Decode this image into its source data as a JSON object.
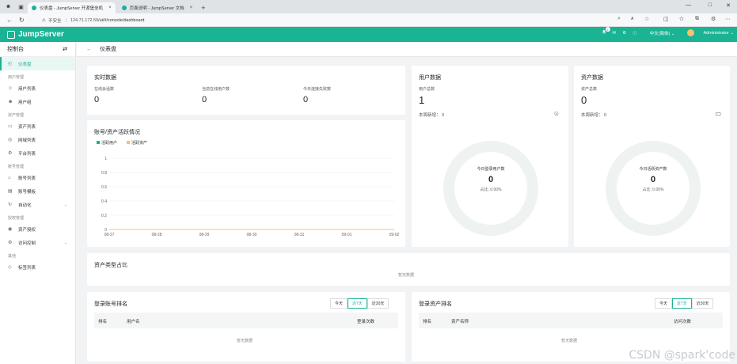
{
  "browser": {
    "tabs": [
      {
        "title": "仪表盘 - JumpServer 开源堡垒机",
        "close": "×"
      },
      {
        "title": "页面说明 - JumpServer 文档",
        "close": "×"
      }
    ],
    "new_tab": "+",
    "security_label": "不安全",
    "host": "124.71.172.59",
    "path": "/ui/#/console/dashboard"
  },
  "header": {
    "brand": "JumpServer",
    "notification_count": "1",
    "language": "中文(简体)",
    "user": "Administrator"
  },
  "sidebar": {
    "title": "控制台",
    "items": [
      {
        "type": "item",
        "label": "仪表盘",
        "icon": "dashboard-icon",
        "active": true
      },
      {
        "type": "group",
        "label": "用户管理"
      },
      {
        "type": "item",
        "label": "用户列表",
        "icon": "user-icon"
      },
      {
        "type": "item",
        "label": "用户组",
        "icon": "user-group-icon"
      },
      {
        "type": "group",
        "label": "资产管理"
      },
      {
        "type": "item",
        "label": "资产列表",
        "icon": "monitor-icon"
      },
      {
        "type": "item",
        "label": "网域列表",
        "icon": "domain-icon"
      },
      {
        "type": "item",
        "label": "平台列表",
        "icon": "platform-icon"
      },
      {
        "type": "group",
        "label": "账号管理"
      },
      {
        "type": "item",
        "label": "账号列表",
        "icon": "lock-icon"
      },
      {
        "type": "item",
        "label": "账号模板",
        "icon": "template-icon"
      },
      {
        "type": "item",
        "label": "自动化",
        "icon": "automation-icon",
        "arrow": true
      },
      {
        "type": "group",
        "label": "授权管理"
      },
      {
        "type": "item",
        "label": "资产授权",
        "icon": "permission-icon"
      },
      {
        "type": "item",
        "label": "访问控制",
        "icon": "access-control-icon",
        "arrow": true
      },
      {
        "type": "group",
        "label": "其他"
      },
      {
        "type": "item",
        "label": "标签列表",
        "icon": "tag-icon"
      }
    ]
  },
  "breadcrumb": {
    "title": "仪表盘"
  },
  "realtime": {
    "title": "实时数据",
    "stats": [
      {
        "label": "在线会话数",
        "value": "0"
      },
      {
        "label": "当前在线用户数",
        "value": "0"
      },
      {
        "label": "今日连接失败数",
        "value": "0"
      }
    ]
  },
  "user_data": {
    "title": "用户数据",
    "total_label": "用户总数",
    "total": "1",
    "week_new_label": "本周新增：",
    "week_new": "0",
    "donut_title": "今日登录用户数",
    "donut_value": "0",
    "donut_percent": "占比: 0.00%"
  },
  "asset_data": {
    "title": "资产数据",
    "total_label": "资产总数",
    "total": "0",
    "week_new_label": "本周新增：",
    "week_new": "0",
    "donut_title": "今日活跃资产数",
    "donut_value": "0",
    "donut_percent": "占比: 0.00%"
  },
  "activity_chart": {
    "title": "账号/资产活跃情况",
    "colors": {
      "users": "#1ab394",
      "assets": "#f5c26b",
      "grid": "#e9ebee"
    }
  },
  "chart_data": {
    "type": "line",
    "title": "账号/资产活跃情况",
    "x": [
      "08-27",
      "08-28",
      "08-29",
      "08-30",
      "08-31",
      "09-01",
      "09-02"
    ],
    "yticks": [
      "0",
      "0.2",
      "0.4",
      "0.6",
      "0.8",
      "1"
    ],
    "ylim": [
      0,
      1
    ],
    "series": [
      {
        "name": "活跃用户",
        "values": [
          0,
          0,
          0,
          0,
          0,
          0,
          0
        ],
        "color": "#1ab394"
      },
      {
        "name": "活跃资产",
        "values": [
          0,
          0,
          0,
          0,
          0,
          0,
          0
        ],
        "color": "#f5c26b"
      }
    ],
    "grid": true,
    "legend": "top-left"
  },
  "asset_type": {
    "title": "资产类型占比",
    "empty": "暂无数据"
  },
  "login_account_rank": {
    "title": "登录账号排名",
    "ranges": [
      "今天",
      "近7天",
      "近30天"
    ],
    "selected": "近7天",
    "columns": [
      "排名",
      "用户名",
      "登录次数"
    ],
    "empty": "暂无数据"
  },
  "login_asset_rank": {
    "title": "登录资产排名",
    "ranges": [
      "今天",
      "近7天",
      "近30天"
    ],
    "selected": "近7天",
    "columns": [
      "排名",
      "资产名称",
      "访问次数"
    ],
    "empty": "暂无数据"
  },
  "watermark": "CSDN @spark'code"
}
